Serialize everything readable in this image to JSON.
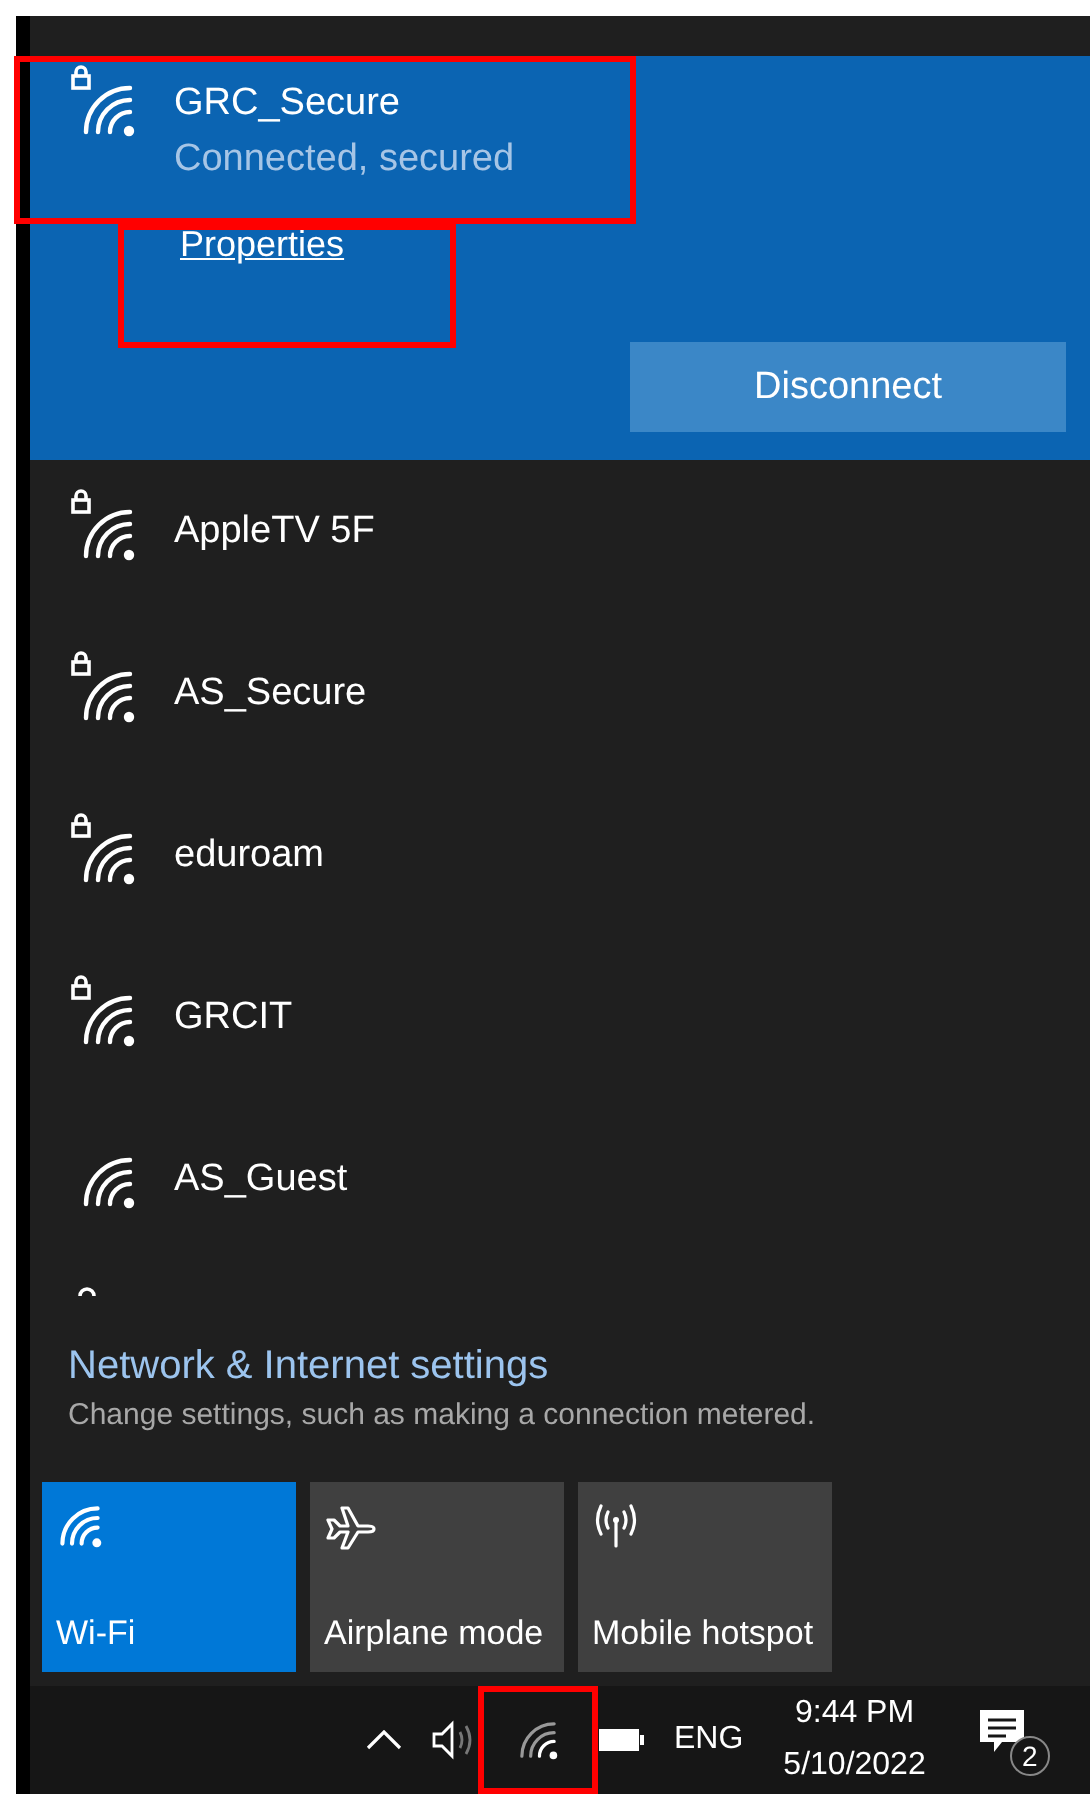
{
  "networks": [
    {
      "name": "GRC_Secure",
      "secured": true,
      "selected": true,
      "highlighted": true,
      "status": "Connected, secured",
      "properties_link": {
        "label": "Properties",
        "highlighted": true
      },
      "action_button": "Disconnect"
    },
    {
      "name": "AppleTV 5F",
      "secured": true,
      "selected": false
    },
    {
      "name": "AS_Secure",
      "secured": true,
      "selected": false
    },
    {
      "name": "eduroam",
      "secured": true,
      "selected": false
    },
    {
      "name": "GRCIT",
      "secured": true,
      "selected": false
    },
    {
      "name": "AS_Guest",
      "secured": false,
      "selected": false
    }
  ],
  "settings": {
    "title": "Network & Internet settings",
    "subtitle": "Change settings, such as making a connection metered."
  },
  "tiles": [
    {
      "kind": "wifi",
      "label": "Wi-Fi",
      "on": true
    },
    {
      "kind": "airplane",
      "label": "Airplane mode",
      "on": false
    },
    {
      "kind": "hotspot",
      "label": "Mobile hotspot",
      "on": false
    }
  ],
  "taskbar": {
    "language": "ENG",
    "time": "9:44 PM",
    "date": "5/10/2022",
    "notification_count": "2",
    "wifi_highlighted": true
  }
}
